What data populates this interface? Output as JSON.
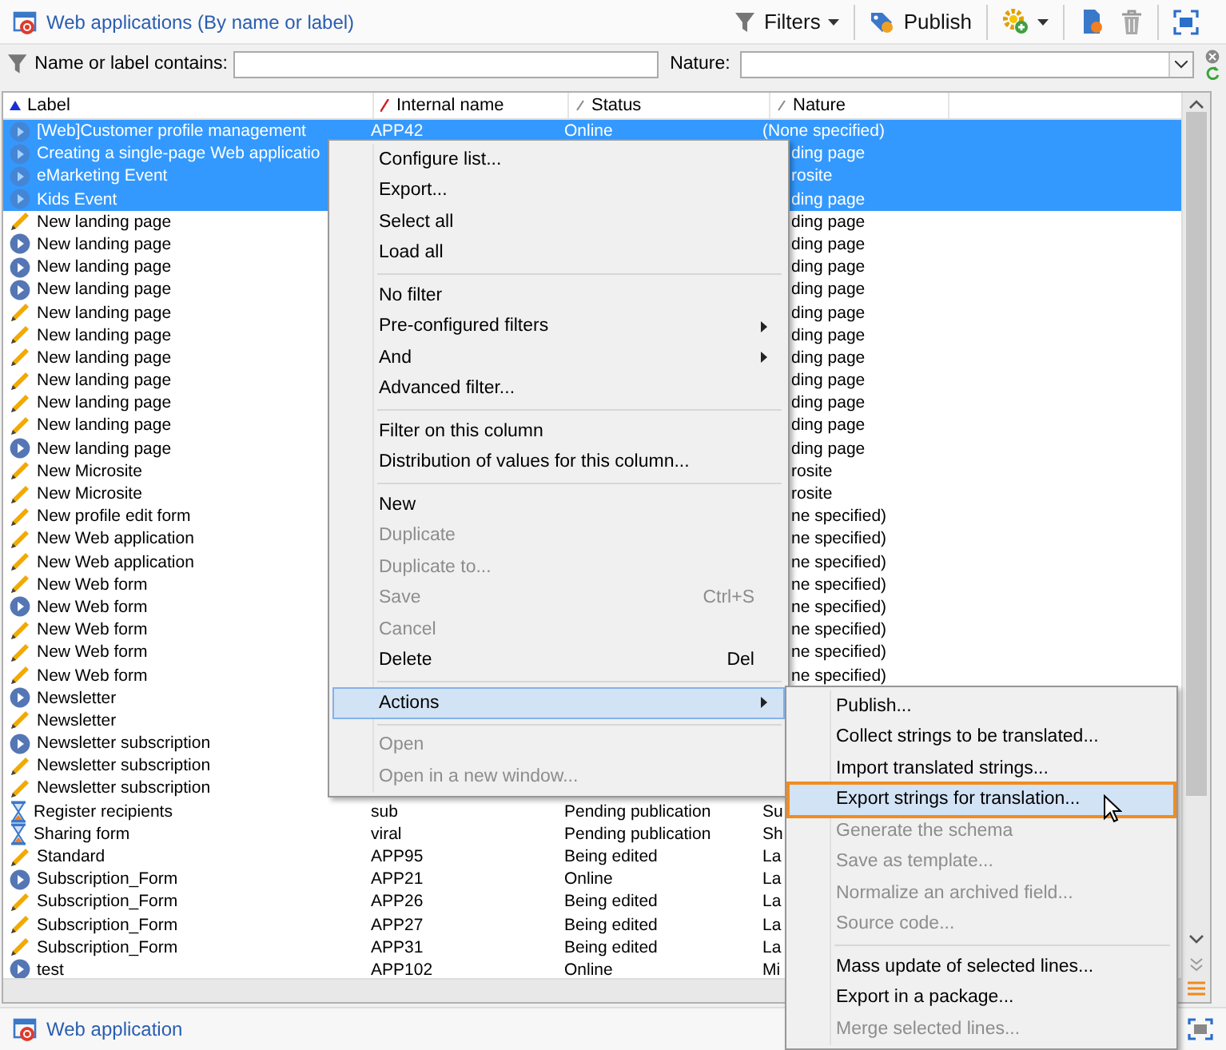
{
  "toolbar": {
    "title": "Web applications (By name or label)",
    "groups": [
      [
        {
          "kind": "filters",
          "label": "Filters",
          "dropdown": true
        }
      ],
      [
        {
          "kind": "publish",
          "label": "Publish",
          "dropdown": false
        }
      ],
      [
        {
          "kind": "gear",
          "dropdown": true
        }
      ],
      [
        {
          "kind": "new",
          "dropdown": false
        },
        {
          "kind": "delete",
          "dropdown": false
        }
      ],
      [
        {
          "kind": "fullscreen",
          "dropdown": false
        }
      ]
    ]
  },
  "filter_bar": {
    "name_label": "Name or label contains:",
    "nature_label": "Nature:"
  },
  "table": {
    "columns": [
      {
        "label": "Label",
        "sorted_ascending": true,
        "marked": false
      },
      {
        "label": "Internal name",
        "sorted_ascending": false,
        "marked": true
      },
      {
        "label": "Status",
        "sorted_ascending": false,
        "marked": false
      },
      {
        "label": "Nature",
        "sorted_ascending": false,
        "marked": false
      }
    ],
    "rows": [
      {
        "label": "[Web]Customer profile management",
        "internal_name": "APP42",
        "status": "Online",
        "nature": "(None specified)",
        "kind": "online",
        "selected": true
      },
      {
        "label": "Creating a single-page Web applicatio",
        "nature": "ding page",
        "kind": "online",
        "selected": true
      },
      {
        "label": "eMarketing Event",
        "nature": "rosite",
        "kind": "online",
        "selected": true
      },
      {
        "label": "Kids Event",
        "nature": "ding page",
        "kind": "online",
        "selected": true
      },
      {
        "label": "New landing page",
        "nature": "ding page",
        "kind": "draft",
        "selected": false
      },
      {
        "label": "New landing page",
        "nature": "ding page",
        "kind": "online",
        "selected": false
      },
      {
        "label": "New landing page",
        "nature": "ding page",
        "kind": "online",
        "selected": false
      },
      {
        "label": "New landing page",
        "nature": "ding page",
        "kind": "online",
        "selected": false
      },
      {
        "label": "New landing page",
        "nature": "ding page",
        "kind": "draft",
        "selected": false
      },
      {
        "label": "New landing page",
        "nature": "ding page",
        "kind": "draft",
        "selected": false
      },
      {
        "label": "New landing page",
        "nature": "ding page",
        "kind": "draft",
        "selected": false
      },
      {
        "label": "New landing page",
        "nature": "ding page",
        "kind": "draft",
        "selected": false
      },
      {
        "label": "New landing page",
        "nature": "ding page",
        "kind": "draft",
        "selected": false
      },
      {
        "label": "New landing page",
        "nature": "ding page",
        "kind": "draft",
        "selected": false
      },
      {
        "label": "New landing page",
        "nature": "ding page",
        "kind": "online",
        "selected": false
      },
      {
        "label": "New Microsite",
        "nature": "rosite",
        "kind": "draft",
        "selected": false
      },
      {
        "label": "New Microsite",
        "nature": "rosite",
        "kind": "draft",
        "selected": false
      },
      {
        "label": "New profile edit form",
        "nature": "ne specified)",
        "kind": "draft",
        "selected": false
      },
      {
        "label": "New Web application",
        "nature": "ne specified)",
        "kind": "draft",
        "selected": false
      },
      {
        "label": "New Web application",
        "nature": "ne specified)",
        "kind": "draft",
        "selected": false
      },
      {
        "label": "New Web form",
        "nature": "ne specified)",
        "kind": "draft",
        "selected": false
      },
      {
        "label": "New Web form",
        "nature": "ne specified)",
        "kind": "online",
        "selected": false
      },
      {
        "label": "New Web form",
        "nature": "ne specified)",
        "kind": "draft",
        "selected": false
      },
      {
        "label": "New Web form",
        "nature": "ne specified)",
        "kind": "draft",
        "selected": false
      },
      {
        "label": "New Web form",
        "nature": "ne specified)",
        "kind": "draft",
        "selected": false
      },
      {
        "label": "Newsletter",
        "kind": "online",
        "selected": false
      },
      {
        "label": "Newsletter",
        "kind": "draft",
        "selected": false
      },
      {
        "label": "Newsletter subscription",
        "kind": "online",
        "selected": false
      },
      {
        "label": "Newsletter subscription",
        "kind": "draft",
        "selected": false
      },
      {
        "label": "Newsletter subscription",
        "kind": "draft",
        "selected": false
      },
      {
        "label": "Register recipients",
        "internal_name": "sub",
        "status": "Pending publication",
        "nature": "Su",
        "kind": "pending",
        "selected": false
      },
      {
        "label": "Sharing form",
        "internal_name": "viral",
        "status": "Pending publication",
        "nature": "Sh",
        "kind": "pending",
        "selected": false
      },
      {
        "label": "Standard",
        "internal_name": "APP95",
        "status": "Being edited",
        "nature": "La",
        "kind": "draft",
        "selected": false
      },
      {
        "label": "Subscription_Form",
        "internal_name": "APP21",
        "status": "Online",
        "nature": "La",
        "kind": "online",
        "selected": false
      },
      {
        "label": "Subscription_Form",
        "internal_name": "APP26",
        "status": "Being edited",
        "nature": "La",
        "kind": "draft",
        "selected": false
      },
      {
        "label": "Subscription_Form",
        "internal_name": "APP27",
        "status": "Being edited",
        "nature": "La",
        "kind": "draft",
        "selected": false
      },
      {
        "label": "Subscription_Form",
        "internal_name": "APP31",
        "status": "Being edited",
        "nature": "La",
        "kind": "draft",
        "selected": false
      },
      {
        "label": "test",
        "internal_name": "APP102",
        "status": "Online",
        "nature": "Mi",
        "kind": "online",
        "selected": false
      }
    ]
  },
  "context_menu": {
    "groups": [
      [
        {
          "label": "Configure list...",
          "disabled": false,
          "selected": false,
          "submenu": false
        },
        {
          "label": "Export...",
          "disabled": false,
          "selected": false,
          "submenu": false
        },
        {
          "label": "Select all",
          "disabled": false,
          "selected": false,
          "submenu": false
        },
        {
          "label": "Load all",
          "disabled": false,
          "selected": false,
          "submenu": false
        }
      ],
      [
        {
          "label": "No filter",
          "disabled": false,
          "selected": false,
          "submenu": false
        },
        {
          "label": "Pre-configured filters",
          "disabled": false,
          "selected": false,
          "submenu": true
        },
        {
          "label": "And",
          "disabled": false,
          "selected": false,
          "submenu": true
        },
        {
          "label": "Advanced filter...",
          "disabled": false,
          "selected": false,
          "submenu": false
        }
      ],
      [
        {
          "label": "Filter on this column",
          "disabled": false,
          "selected": false,
          "submenu": false
        },
        {
          "label": "Distribution of values for this column...",
          "disabled": false,
          "selected": false,
          "submenu": false
        }
      ],
      [
        {
          "label": "New",
          "disabled": false,
          "selected": false,
          "submenu": false
        },
        {
          "label": "Duplicate",
          "disabled": true,
          "selected": false,
          "submenu": false
        },
        {
          "label": "Duplicate to...",
          "disabled": true,
          "selected": false,
          "submenu": false
        },
        {
          "label": "Save",
          "shortcut": "Ctrl+S",
          "disabled": true,
          "selected": false,
          "submenu": false
        },
        {
          "label": "Cancel",
          "disabled": true,
          "selected": false,
          "submenu": false
        },
        {
          "label": "Delete",
          "shortcut": "Del",
          "disabled": false,
          "selected": false,
          "submenu": false
        }
      ],
      [
        {
          "label": "Actions",
          "disabled": false,
          "selected": true,
          "submenu": true
        }
      ],
      [
        {
          "label": "Open",
          "disabled": true,
          "selected": false,
          "submenu": false
        },
        {
          "label": "Open in a new window...",
          "disabled": true,
          "selected": false,
          "submenu": false
        }
      ]
    ]
  },
  "actions_menu": {
    "groups": [
      [
        {
          "label": "Publish...",
          "disabled": false,
          "selected": false
        },
        {
          "label": "Collect strings to be translated...",
          "disabled": false,
          "selected": false
        },
        {
          "label": "Import translated strings...",
          "disabled": false,
          "selected": false
        },
        {
          "label": "Export strings for translation...",
          "disabled": false,
          "selected": true
        },
        {
          "label": "Generate the schema",
          "disabled": true,
          "selected": false
        },
        {
          "label": "Save as template...",
          "disabled": true,
          "selected": false
        },
        {
          "label": "Normalize an archived field...",
          "disabled": true,
          "selected": false
        },
        {
          "label": "Source code...",
          "disabled": true,
          "selected": false
        }
      ],
      [
        {
          "label": "Mass update of selected lines...",
          "disabled": false,
          "selected": false
        },
        {
          "label": "Export in a package...",
          "disabled": false,
          "selected": false
        },
        {
          "label": "Merge selected lines...",
          "disabled": true,
          "selected": false
        }
      ]
    ]
  },
  "status_bar": {
    "link": "Web application"
  }
}
